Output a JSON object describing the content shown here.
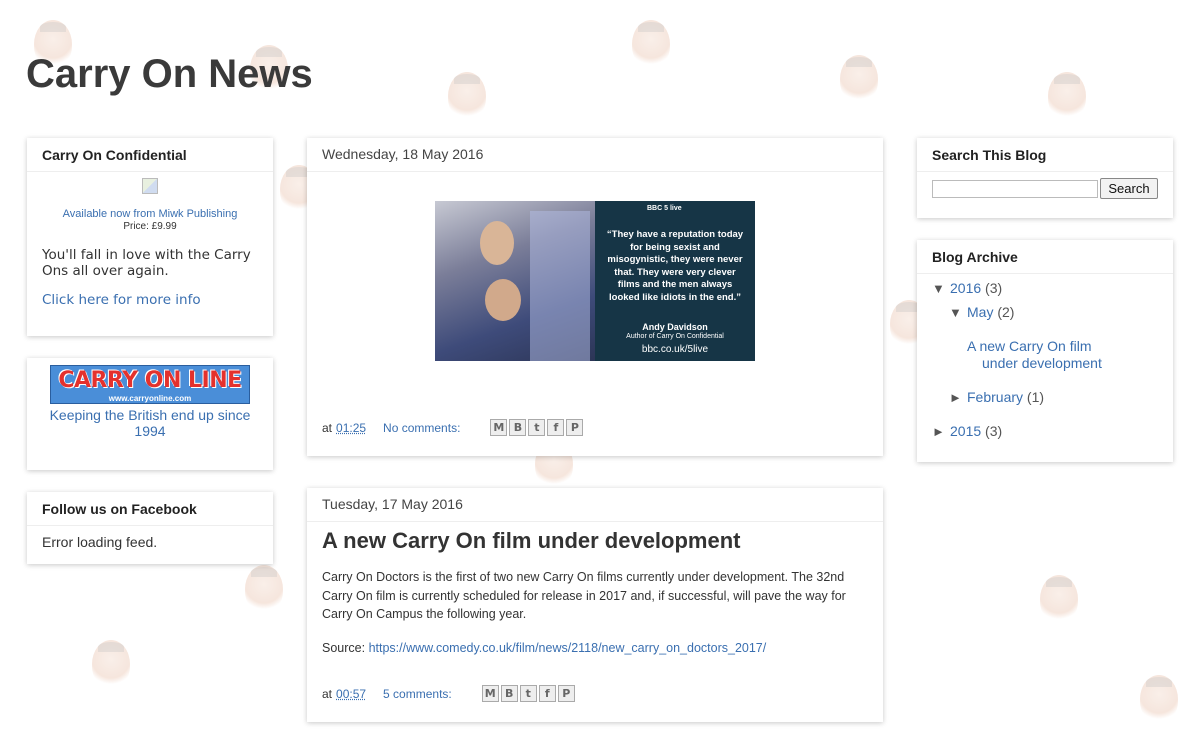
{
  "blog": {
    "title": "Carry On News"
  },
  "sidebar_left": {
    "confidential": {
      "title": "Carry On Confidential",
      "available": "Available now from Miwk Publishing",
      "price": "Price: £9.99",
      "blurb": "You'll fall in love with the Carry Ons all over again.",
      "more_link": "Click here for more info"
    },
    "carryonline": {
      "logo_text": "CARRY ON LINE",
      "logo_url": "www.carryonline.com",
      "tagline": "Keeping the British end up since 1994"
    },
    "facebook": {
      "title": "Follow us on Facebook",
      "status": "Error loading feed."
    }
  },
  "posts": [
    {
      "date": "Wednesday, 18 May 2016",
      "image": {
        "quote": "“They have a reputation today for being sexist and misogynistic, they were never that. They were very clever films and the men always looked like idiots in the end.”",
        "author": "Andy Davidson",
        "author_role": "Author of Carry On Confidential",
        "url": "bbc.co.uk/5live",
        "logo": "BBC 5 live"
      },
      "footer": {
        "at": "at",
        "time": "01:25",
        "comments": "No comments:"
      }
    },
    {
      "date": "Tuesday, 17 May 2016",
      "title": "A new Carry On film under development",
      "body": "Carry On Doctors is the first of two new Carry On films currently under development.  The 32nd Carry On film is currently scheduled for release in 2017 and, if successful, will pave the way for Carry On Campus the following year.",
      "source_label": "Source:",
      "source_url": "https://www.comedy.co.uk/film/news/2118/new_carry_on_doctors_2017/",
      "footer": {
        "at": "at",
        "time": "00:57",
        "comments": "5 comments:"
      }
    }
  ],
  "sidebar_right": {
    "search": {
      "title": "Search This Blog",
      "button": "Search",
      "value": ""
    },
    "archive": {
      "title": "Blog Archive",
      "y2016": {
        "label": "2016",
        "count": "(3)"
      },
      "may": {
        "label": "May",
        "count": "(2)"
      },
      "post_link": "A new Carry On film under development",
      "feb": {
        "label": "February",
        "count": "(1)"
      },
      "y2015": {
        "label": "2015",
        "count": "(3)"
      }
    }
  },
  "share_icons": [
    "email-icon",
    "blogger-icon",
    "twitter-icon",
    "facebook-icon",
    "pinterest-icon"
  ]
}
